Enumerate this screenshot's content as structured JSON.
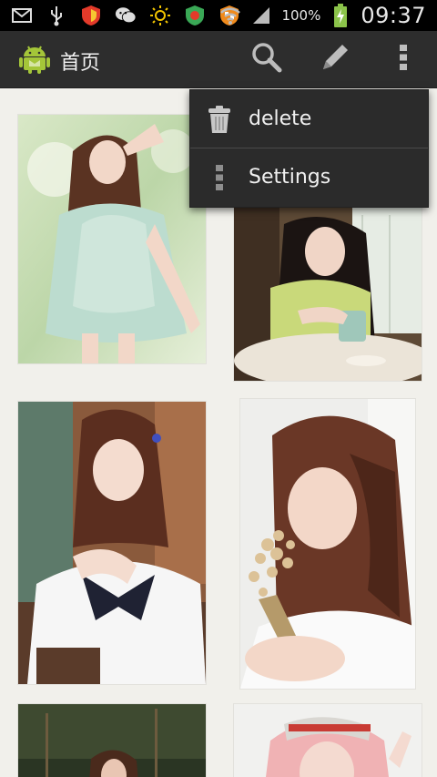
{
  "status_bar": {
    "battery_percent": "100%",
    "time": "09:37",
    "icons": [
      "mail-icon",
      "usb-icon",
      "shield-icon",
      "wechat-icon",
      "sun-icon",
      "security-icon",
      "app-shield-icon",
      "wifi-icon",
      "signal-icon",
      "battery-charging-icon"
    ]
  },
  "action_bar": {
    "title": "首页",
    "icons": [
      "android-logo-icon",
      "search-icon",
      "edit-pencil-icon",
      "overflow-menu-icon"
    ]
  },
  "overflow_menu": {
    "items": [
      {
        "label": "delete",
        "icon": "trash-icon"
      },
      {
        "label": "Settings",
        "icon": "settings-dots-icon"
      }
    ]
  },
  "colors": {
    "status_bar_bg": "#000000",
    "action_bar_bg": "#2d2d2d",
    "menu_bg": "#2b2b2b",
    "page_bg": "#f1f0eb"
  },
  "photos": [
    {
      "name": "photo-girl-white-dress"
    },
    {
      "name": "photo-girl-coffee-cup"
    },
    {
      "name": "photo-girl-school-uniform"
    },
    {
      "name": "photo-girl-flowers"
    },
    {
      "name": "photo-girl-night"
    },
    {
      "name": "photo-girl-pink-hair"
    }
  ]
}
